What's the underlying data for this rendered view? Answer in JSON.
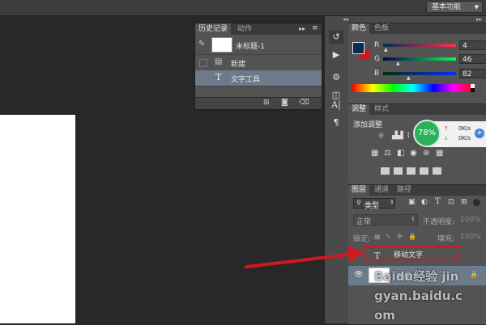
{
  "topbar": {
    "workspace_label": "基本功能"
  },
  "history": {
    "tabs": [
      "历史记录",
      "动作"
    ],
    "snapshot_label": "未标题-1",
    "items": [
      "新建",
      "文字工具"
    ]
  },
  "color_panel": {
    "tabs": [
      "颜色",
      "色板"
    ],
    "r_label": "R",
    "g_label": "G",
    "b_label": "B",
    "r_value": "4",
    "g_value": "46",
    "b_value": "82",
    "foreground_color": "#042e52",
    "background_color": "#cc1b1b"
  },
  "adjustments": {
    "tabs": [
      "调整",
      "样式"
    ],
    "title": "添加调整"
  },
  "speed_widget": {
    "percent": "78%",
    "up": "0K/s",
    "down": "0K/s"
  },
  "layers": {
    "tabs": [
      "图层",
      "通道",
      "路径"
    ],
    "filter_label": "类型",
    "blend_mode": "正常",
    "opacity_label": "不透明度:",
    "opacity_value": "100%",
    "lock_label": "锁定:",
    "fill_label": "填充:",
    "fill_value": "100%",
    "text_layer_name": "移动文字",
    "bg_layer_name": "背景"
  },
  "watermark": "Baidu经验 jingyan.baidu.com"
}
